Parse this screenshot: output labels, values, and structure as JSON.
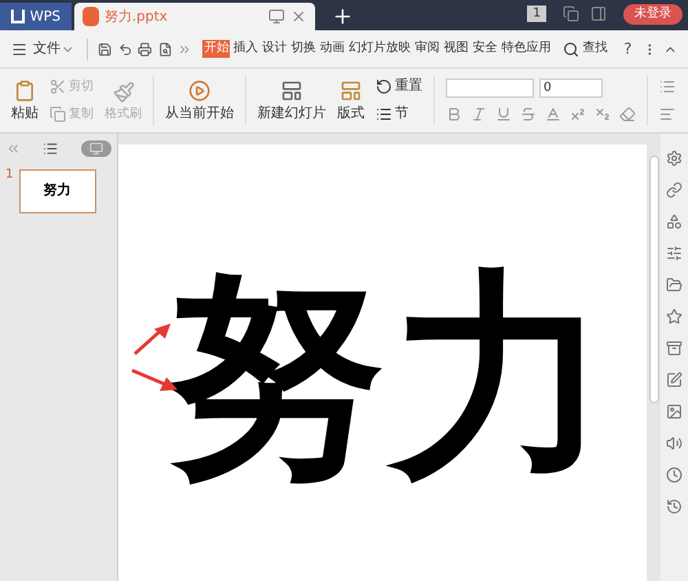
{
  "title_bar": {
    "app_tab": "WPS",
    "doc_tab": "努力.pptx",
    "window_count": "1",
    "login_button": "未登录"
  },
  "menu": {
    "file": "文件",
    "tabs": [
      {
        "label": "开始",
        "selected": true
      },
      {
        "label": "插入",
        "selected": false
      },
      {
        "label": "设计",
        "selected": false
      },
      {
        "label": "切换",
        "selected": false
      },
      {
        "label": "动画",
        "selected": false
      },
      {
        "label": "幻灯片放映",
        "selected": false
      },
      {
        "label": "审阅",
        "selected": false
      },
      {
        "label": "视图",
        "selected": false
      },
      {
        "label": "安全",
        "selected": false
      },
      {
        "label": "特色应用",
        "selected": false
      }
    ],
    "search": "查找",
    "help": "?"
  },
  "ribbon": {
    "paste": "粘贴",
    "cut": {
      "label": "剪切",
      "disabled": true
    },
    "copy": {
      "label": "复制",
      "disabled": true
    },
    "format_painter": {
      "label": "格式刷",
      "disabled": true
    },
    "play_from_current": "从当前开始",
    "new_slide": "新建幻灯片",
    "layout": "版式",
    "reset": "重置",
    "section": "节",
    "font_size": "0"
  },
  "slides_panel": {
    "slide_view_on": true,
    "thumbnails": [
      {
        "number": "1",
        "selected": true,
        "text": "努力"
      }
    ]
  },
  "slide": {
    "text": "努力"
  }
}
